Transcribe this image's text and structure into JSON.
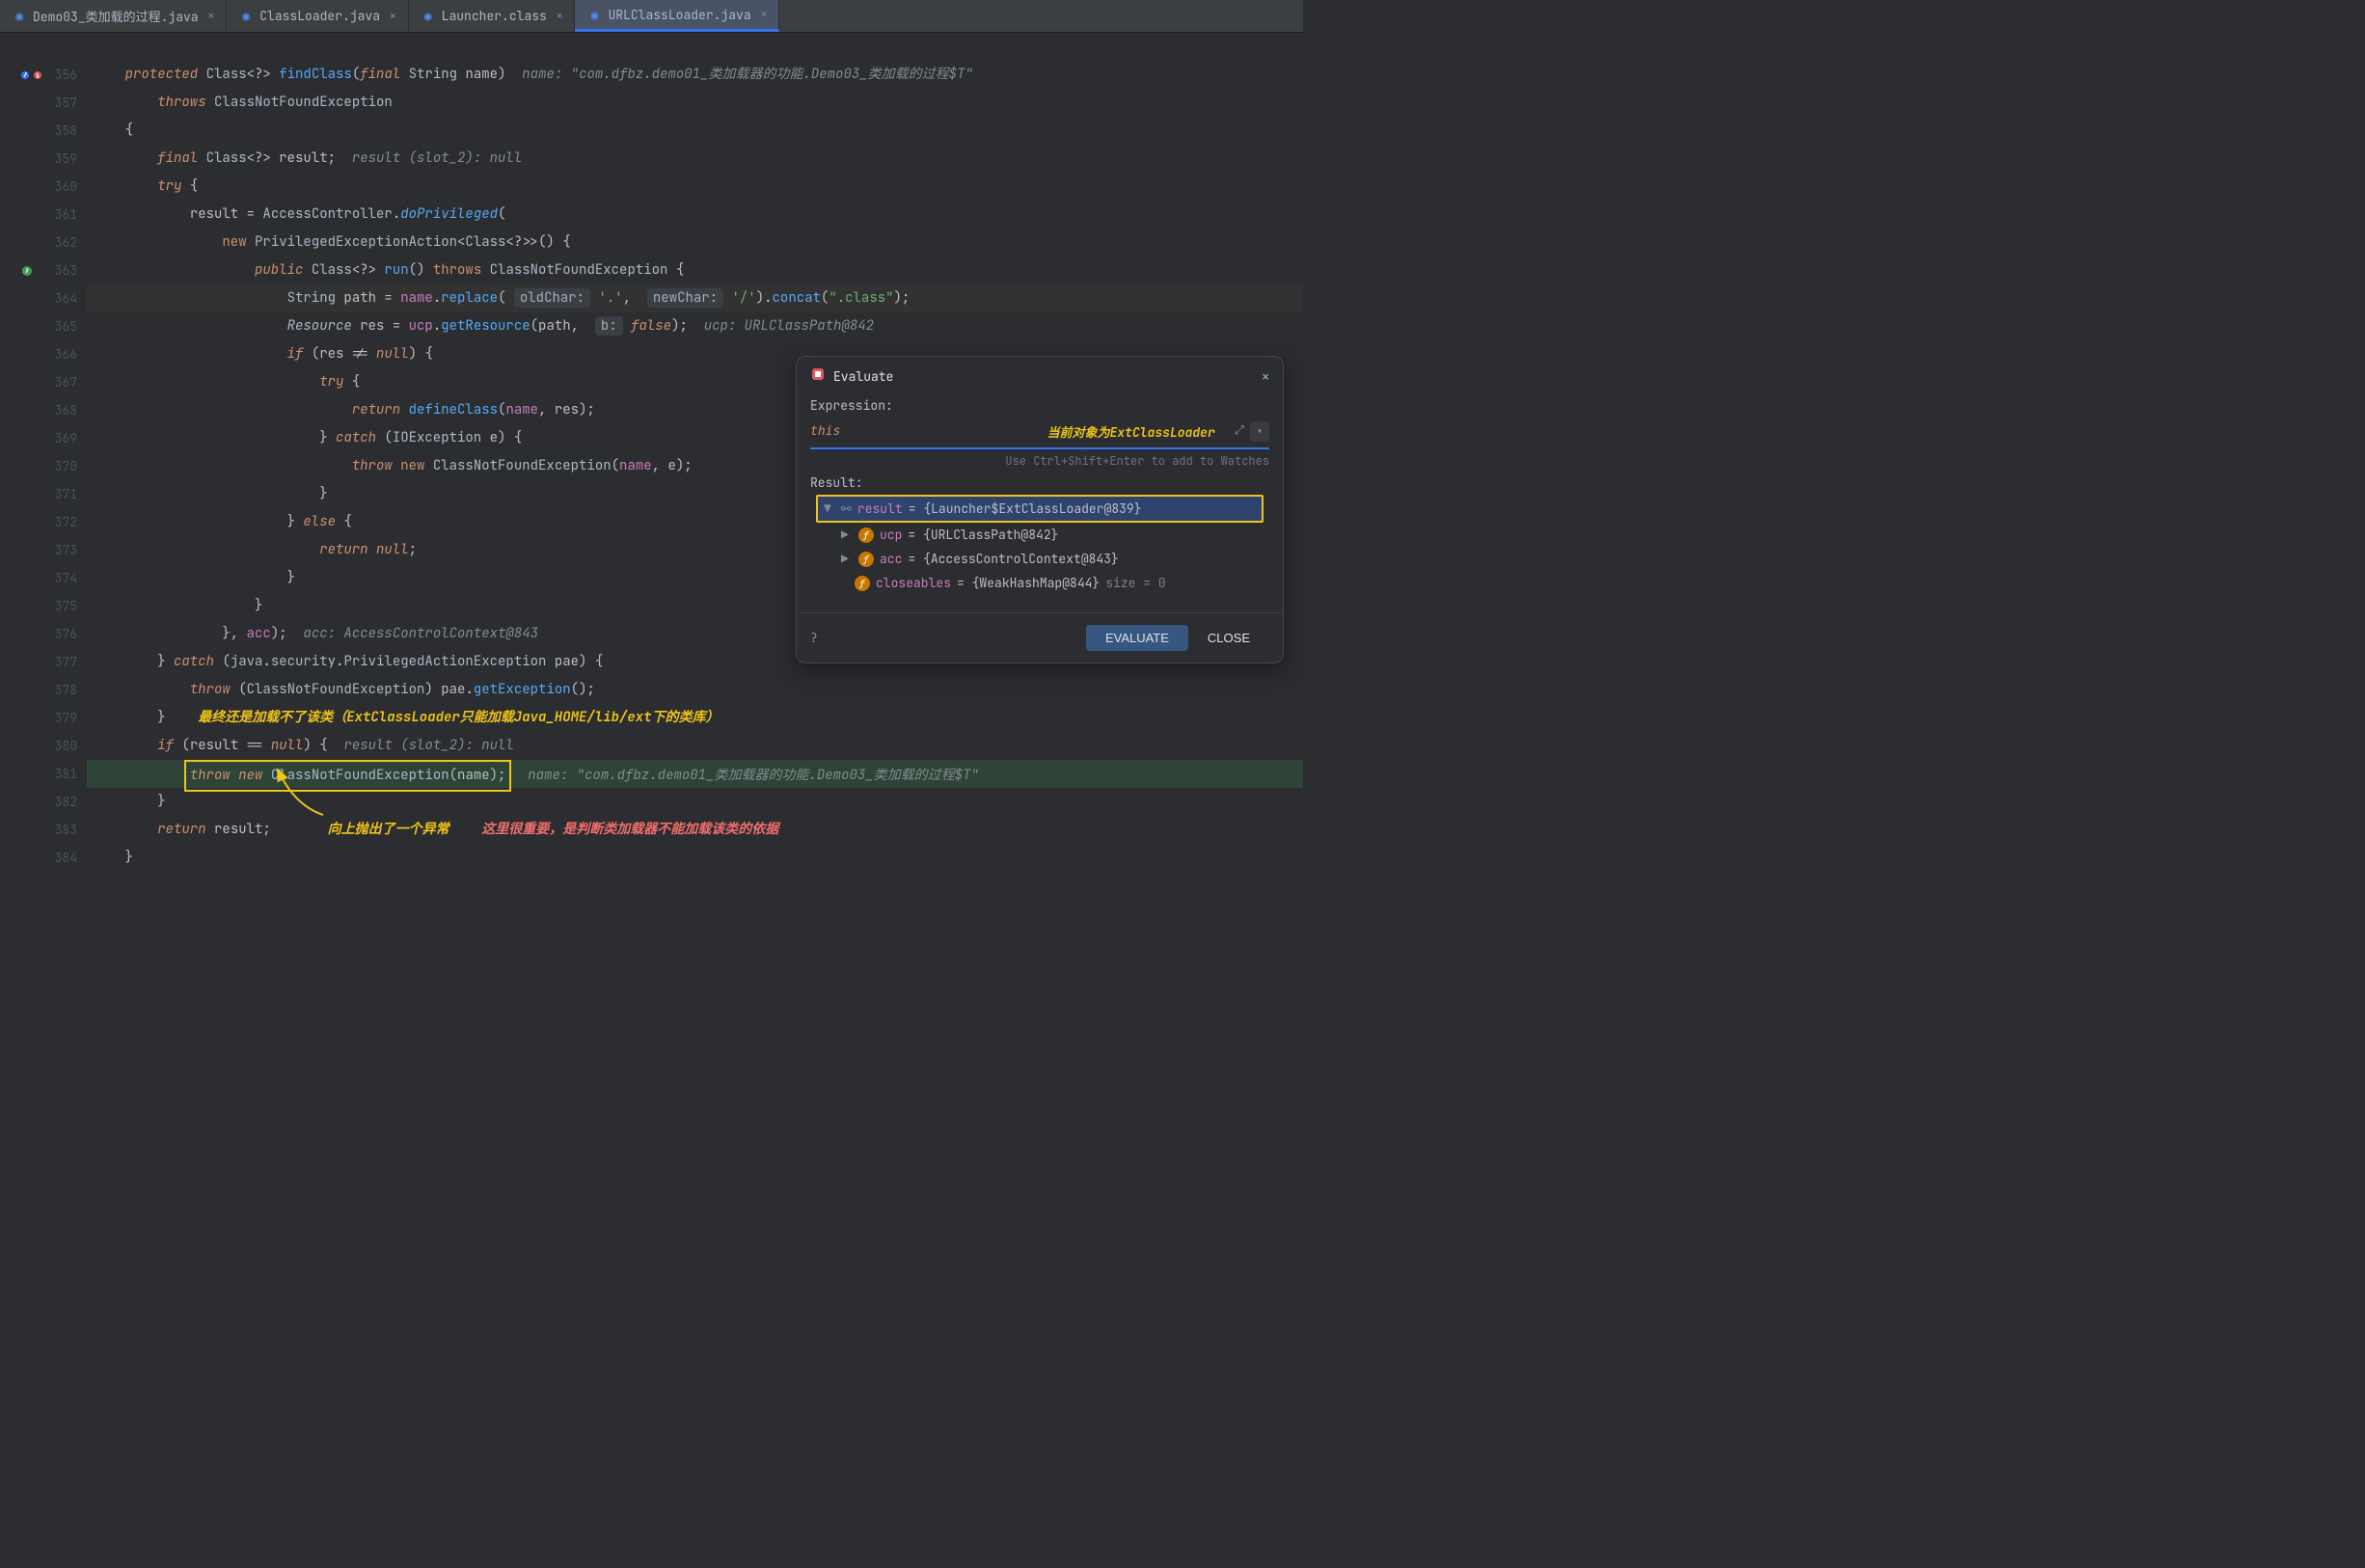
{
  "tabs": [
    {
      "label": "Demo03_类加载的过程.java"
    },
    {
      "label": "ClassLoader.java"
    },
    {
      "label": "Launcher.class"
    },
    {
      "label": "URLClassLoader.java"
    }
  ],
  "lines": {
    "l356": {
      "n": "356",
      "hint": "name: \"com.dfbz.demo01_类加载器的功能.Demo03_类加载的过程$T\""
    },
    "l357": {
      "n": "357"
    },
    "l358": {
      "n": "358"
    },
    "l359": {
      "n": "359",
      "hint": "result (slot_2): null"
    },
    "l360": {
      "n": "360"
    },
    "l361": {
      "n": "361"
    },
    "l362": {
      "n": "362"
    },
    "l363": {
      "n": "363"
    },
    "l364": {
      "n": "364",
      "b1": "oldChar:",
      "b2": "newChar:"
    },
    "l365": {
      "n": "365",
      "hint": "ucp: URLClassPath@842",
      "b": "b:"
    },
    "l366": {
      "n": "366"
    },
    "l367": {
      "n": "367"
    },
    "l368": {
      "n": "368"
    },
    "l369": {
      "n": "369"
    },
    "l370": {
      "n": "370"
    },
    "l371": {
      "n": "371"
    },
    "l372": {
      "n": "372"
    },
    "l373": {
      "n": "373"
    },
    "l374": {
      "n": "374"
    },
    "l375": {
      "n": "375"
    },
    "l376": {
      "n": "376",
      "hint": "acc: AccessControlContext@843"
    },
    "l377": {
      "n": "377"
    },
    "l378": {
      "n": "378"
    },
    "l379": {
      "n": "379"
    },
    "l380": {
      "n": "380",
      "hint": "result (slot_2): null"
    },
    "l381": {
      "n": "381",
      "hint": "name: \"com.dfbz.demo01_类加载器的功能.Demo03_类加载的过程$T\""
    },
    "l382": {
      "n": "382"
    },
    "l383": {
      "n": "383"
    },
    "l384": {
      "n": "384"
    }
  },
  "keywords": {
    "protected": "protected",
    "final": "final",
    "throws": "throws",
    "try": "try",
    "new": "new",
    "public": "public",
    "if": "if",
    "return": "return",
    "catch": "catch",
    "throw": "throw",
    "else": "else",
    "null": "null",
    "false": "false",
    "this": "this"
  },
  "idents": {
    "Class": "Class",
    "findClass": "findClass",
    "String": "String",
    "name": "name",
    "ClassNotFoundException": "ClassNotFoundException",
    "result": "result",
    "AccessController": "AccessController",
    "doPrivileged": "doPrivileged",
    "PrivilegedExceptionAction": "PrivilegedExceptionAction",
    "run": "run",
    "path": "path",
    "replace": "replace",
    "concat": "concat",
    "Resource": "Resource",
    "res": "res",
    "ucp": "ucp",
    "getResource": "getResource",
    "defineClass": "defineClass",
    "IOException": "IOException",
    "e": "e",
    "acc": "acc",
    "java": "java",
    "security": "security",
    "PrivilegedActionException": "PrivilegedActionException",
    "pae": "pae",
    "getException": "getException"
  },
  "strings": {
    "dot": "'.'",
    "slash": "'/'",
    "classExt": "\".class\""
  },
  "annotations": {
    "evalNote": "当前对象为ExtClassLoader",
    "note379": "最终还是加载不了该类（ExtClassLoader只能加载Java_HOME/lib/ext下的类库）",
    "arrowLabel": "向上抛出了一个异常",
    "redNote": "这里很重要，是判断类加载器不能加载该类的依据"
  },
  "eval": {
    "title": "Evaluate",
    "exprLabel": "Expression:",
    "expr": "this",
    "hint": "Use Ctrl+Shift+Enter to add to Watches",
    "resultLabel": "Result:",
    "results": {
      "root": {
        "name": "result",
        "val": "{Launcher$ExtClassLoader@839}"
      },
      "ucp": {
        "name": "ucp",
        "val": "{URLClassPath@842}"
      },
      "acc": {
        "name": "acc",
        "val": "{AccessControlContext@843}"
      },
      "closeables": {
        "name": "closeables",
        "val": "{WeakHashMap@844}",
        "extra": "size = 0"
      }
    },
    "evaluateBtn": "EVALUATE",
    "closeBtn": "CLOSE"
  }
}
